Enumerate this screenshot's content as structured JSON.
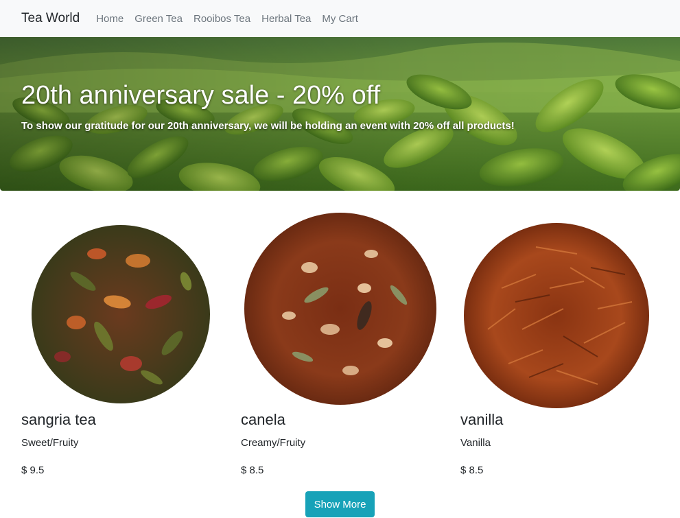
{
  "navbar": {
    "brand": "Tea World",
    "links": [
      "Home",
      "Green Tea",
      "Rooibos Tea",
      "Herbal Tea",
      "My Cart"
    ]
  },
  "hero": {
    "title": "20th anniversary sale - 20% off",
    "subtitle": "To show our gratitude for our 20th anniversary, we will be holding an event with 20% off all products!"
  },
  "products": [
    {
      "name": "sangria tea",
      "description": "Sweet/Fruity",
      "price": "$ 9.5"
    },
    {
      "name": "canela",
      "description": "Creamy/Fruity",
      "price": "$ 8.5"
    },
    {
      "name": "vanilla",
      "description": "Vanilla",
      "price": "$ 8.5"
    }
  ],
  "show_more_label": "Show More",
  "colors": {
    "navbar_bg": "#f8f9fa",
    "nav_link": "#6c757d",
    "button_bg": "#17a2b8",
    "leaf_green": "#6a9a2a"
  }
}
